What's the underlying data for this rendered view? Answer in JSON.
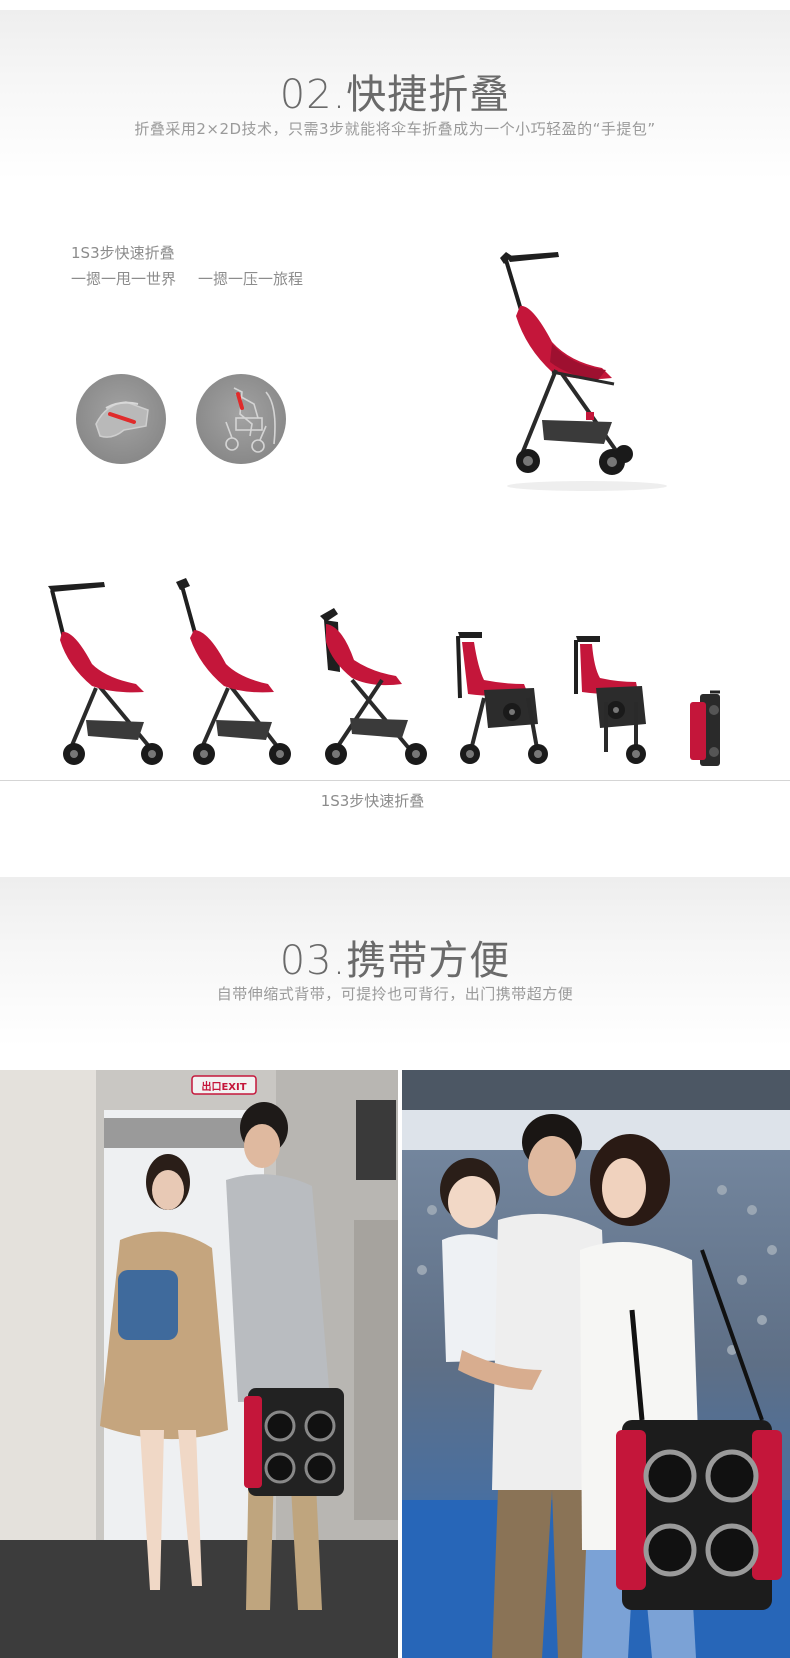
{
  "section_fold": {
    "title": "02.快捷折叠",
    "subtitle": "折叠采用2×2D技术，只需3步就能将伞车折叠成为一个小巧轻盈的“手提包”",
    "label_line1": "1S3步快速折叠",
    "label_line2a": "一摁一甩一世界",
    "label_line2b": "一摁一压一旅程",
    "caption": "1S3步快速折叠"
  },
  "section_carry": {
    "title": "03.携带方便",
    "subtitle": "自带伸缩式背带，可提拎也可背行，出门携带超方便",
    "exit_sign": "出口EXIT"
  },
  "colors": {
    "fabric": "#c4163a",
    "frame": "#222222",
    "text_title": "#6a6a6a",
    "text_sub": "#9a9a9a"
  }
}
